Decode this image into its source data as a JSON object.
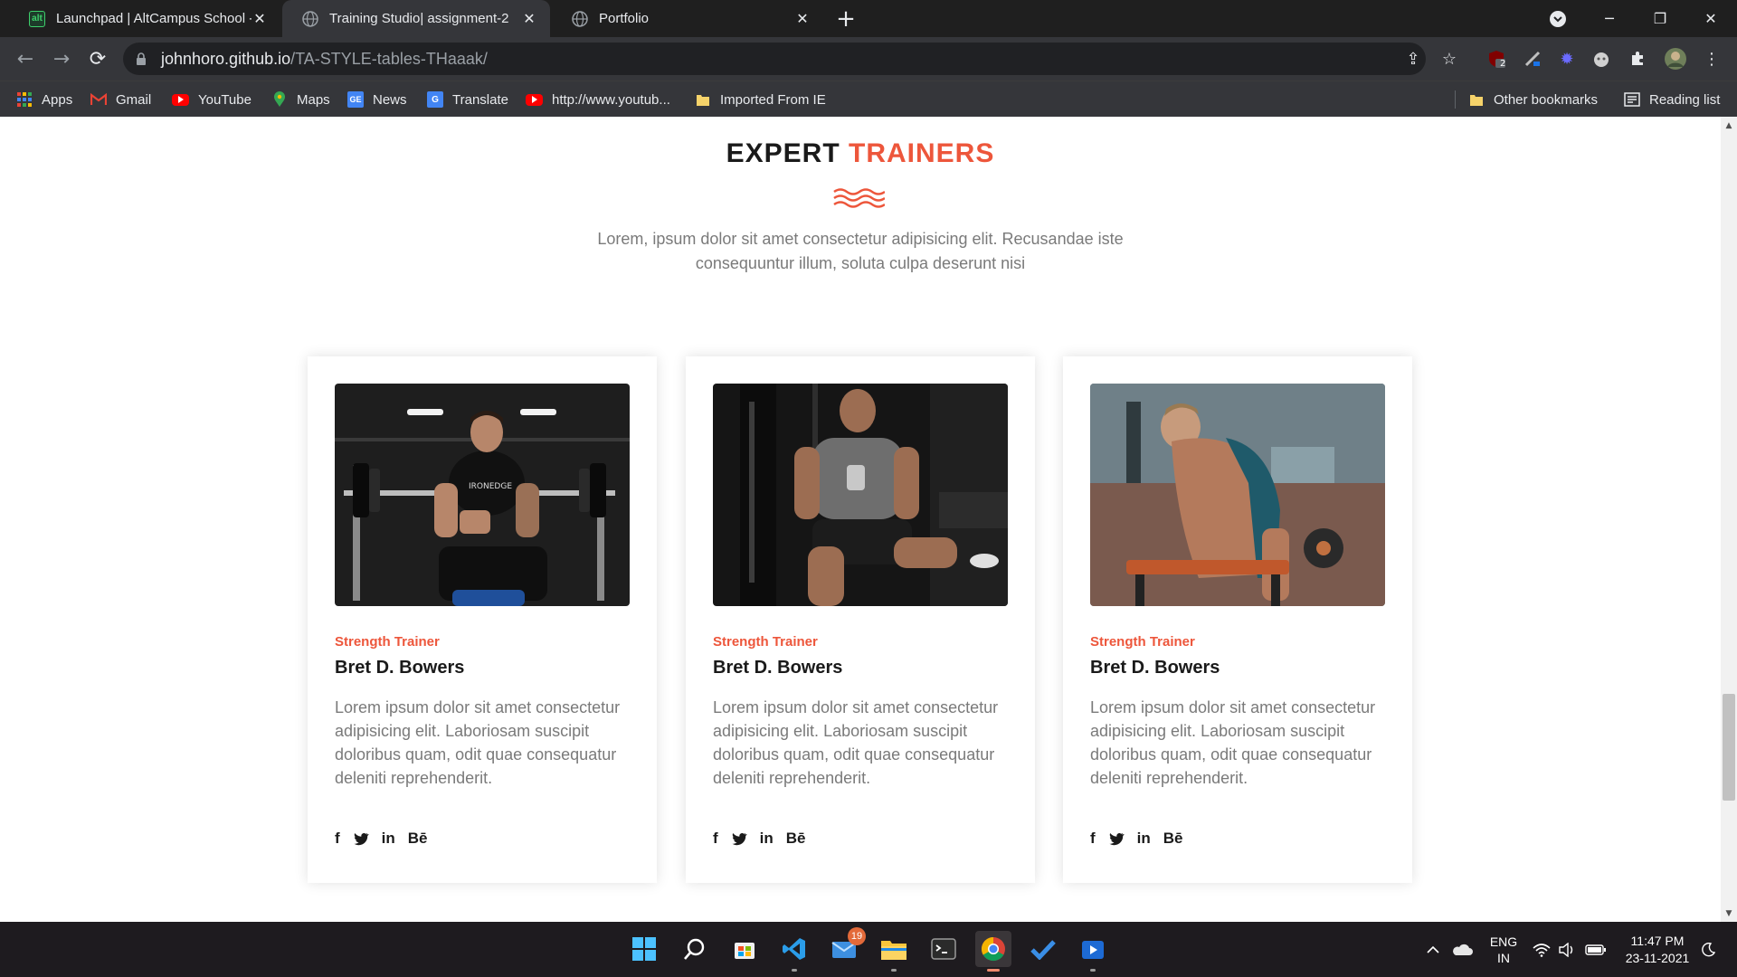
{
  "browser": {
    "tabs": [
      {
        "title": "Launchpad | AltCampus School -",
        "favicon": "altcampus-icon",
        "active": false
      },
      {
        "title": "Training Studio| assignment-2",
        "favicon": "globe-icon",
        "active": true
      },
      {
        "title": "Portfolio",
        "favicon": "globe-icon",
        "active": false
      }
    ],
    "url_host": "johnhoro.github.io",
    "url_path": "/TA-STYLE-tables-THaaak/",
    "bookmarks": [
      {
        "label": "Apps",
        "icon": "apps-grid-icon"
      },
      {
        "label": "Gmail",
        "icon": "gmail-icon"
      },
      {
        "label": "YouTube",
        "icon": "youtube-icon"
      },
      {
        "label": "Maps",
        "icon": "maps-icon"
      },
      {
        "label": "News",
        "icon": "news-icon"
      },
      {
        "label": "Translate",
        "icon": "translate-icon"
      },
      {
        "label": "http://www.youtub...",
        "icon": "youtube-icon"
      },
      {
        "label": "Imported From IE",
        "icon": "folder-icon"
      }
    ],
    "other_bookmarks": "Other bookmarks",
    "reading_list": "Reading list",
    "extension_badge": "2"
  },
  "page": {
    "heading_part1": "EXPERT",
    "heading_part2": "TRAINERS",
    "intro": "Lorem, ipsum dolor sit amet consectetur adipisicing elit. Recusandae iste consequuntur illum, soluta culpa deserunt nisi",
    "trainers": [
      {
        "role": "Strength Trainer",
        "name": "Bret D. Bowers",
        "description": "Lorem ipsum dolor sit amet consectetur adipisicing elit. Laboriosam suscipit doloribus quam, odit quae consequatur deleniti reprehenderit.",
        "social": [
          "f",
          "twitter",
          "in",
          "Bē"
        ]
      },
      {
        "role": "Strength Trainer",
        "name": "Bret D. Bowers",
        "description": "Lorem ipsum dolor sit amet consectetur adipisicing elit. Laboriosam suscipit doloribus quam, odit quae consequatur deleniti reprehenderit.",
        "social": [
          "f",
          "twitter",
          "in",
          "Bē"
        ]
      },
      {
        "role": "Strength Trainer",
        "name": "Bret D. Bowers",
        "description": "Lorem ipsum dolor sit amet consectetur adipisicing elit. Laboriosam suscipit doloribus quam, odit quae consequatur deleniti reprehenderit.",
        "social": [
          "f",
          "twitter",
          "in",
          "Bē"
        ]
      }
    ],
    "accent_color": "#ed563b"
  },
  "taskbar": {
    "mail_badge": "19",
    "lang_line1": "ENG",
    "lang_line2": "IN",
    "time": "11:47 PM",
    "date": "23-11-2021"
  }
}
